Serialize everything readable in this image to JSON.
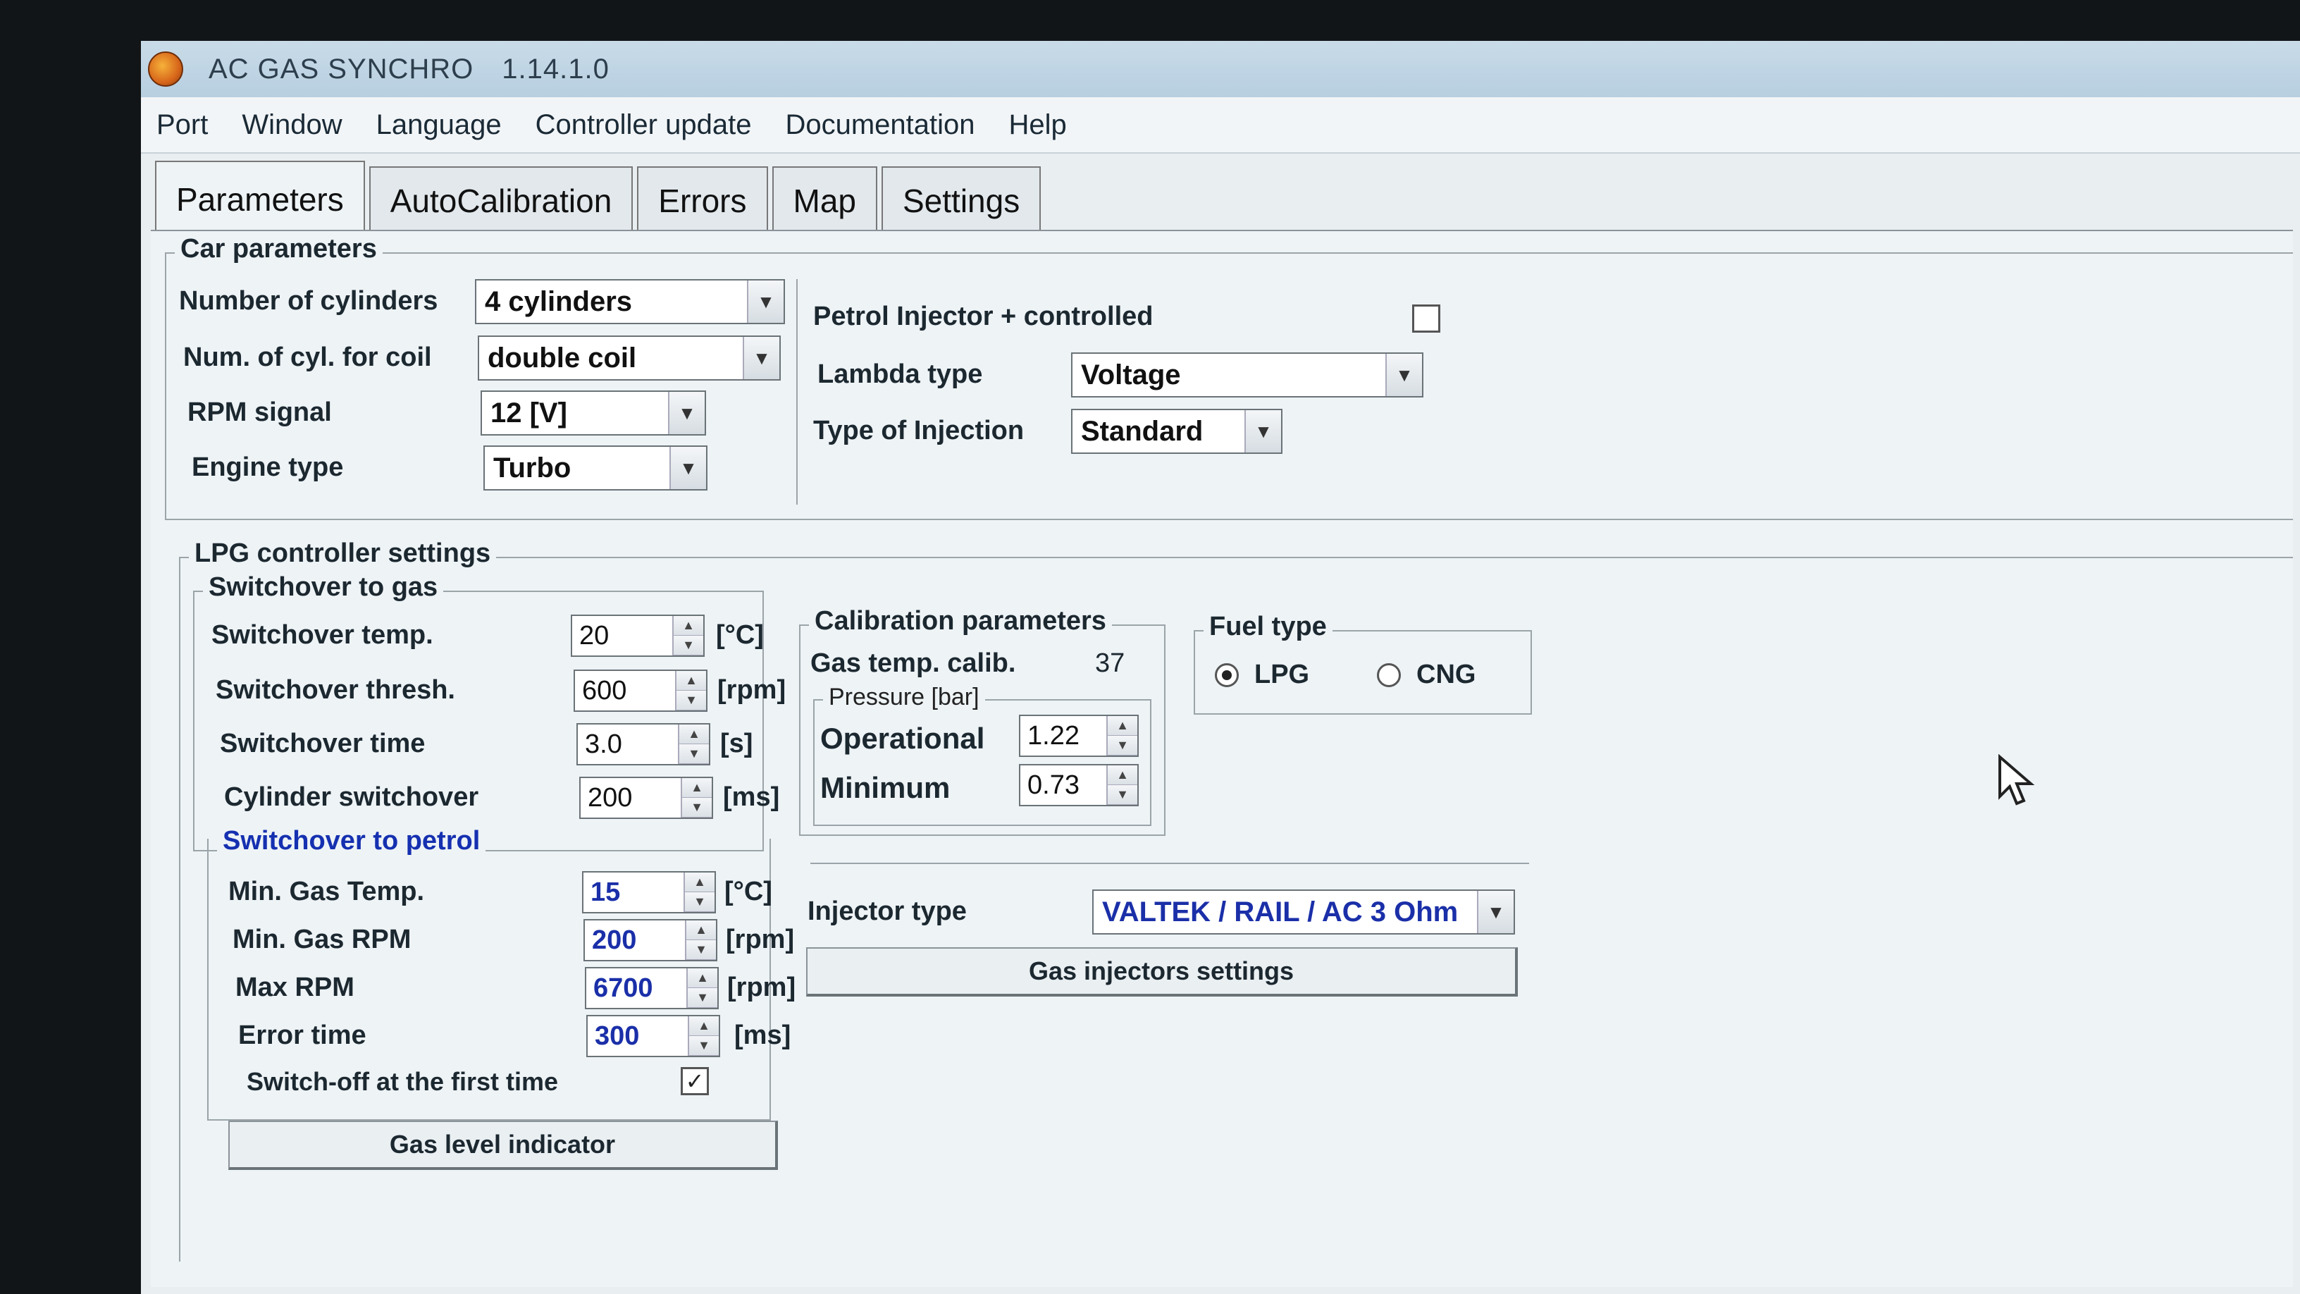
{
  "window": {
    "title": "AC GAS SYNCHRO",
    "version": "1.14.1.0"
  },
  "menu": [
    "Port",
    "Window",
    "Language",
    "Controller update",
    "Documentation",
    "Help"
  ],
  "tabs": [
    "Parameters",
    "AutoCalibration",
    "Errors",
    "Map",
    "Settings"
  ],
  "car_parameters": {
    "legend": "Car parameters",
    "num_cylinders_label": "Number of cylinders",
    "num_cylinders_value": "4 cylinders",
    "cyl_for_coil_label": "Num. of cyl. for coil",
    "cyl_for_coil_value": "double coil",
    "rpm_signal_label": "RPM signal",
    "rpm_signal_value": "12 [V]",
    "engine_type_label": "Engine type",
    "engine_type_value": "Turbo",
    "petrol_injector_label": "Petrol Injector + controlled",
    "lambda_type_label": "Lambda type",
    "lambda_type_value": "Voltage",
    "injection_type_label": "Type of Injection",
    "injection_type_value": "Standard"
  },
  "lpg_settings": {
    "legend": "LPG controller settings",
    "switchover_to_gas": {
      "legend": "Switchover to gas",
      "rows": [
        {
          "label": "Switchover temp.",
          "value": "20",
          "unit": "[°C]"
        },
        {
          "label": "Switchover thresh.",
          "value": "600",
          "unit": "[rpm]"
        },
        {
          "label": "Switchover time",
          "value": "3.0",
          "unit": "[s]"
        },
        {
          "label": "Cylinder switchover",
          "value": "200",
          "unit": "[ms]"
        }
      ]
    },
    "switchover_to_petrol": {
      "legend": "Switchover to petrol",
      "rows": [
        {
          "label": "Min. Gas Temp.",
          "value": "15",
          "unit": "[°C]"
        },
        {
          "label": "Min. Gas RPM",
          "value": "200",
          "unit": "[rpm]"
        },
        {
          "label": "Max RPM",
          "value": "6700",
          "unit": "[rpm]"
        },
        {
          "label": "Error time",
          "value": "300",
          "unit": "[ms]"
        }
      ],
      "switch_off_label": "Switch-off at the first time"
    },
    "gas_level_button": "Gas level indicator",
    "calibration": {
      "legend": "Calibration parameters",
      "gas_temp_label": "Gas temp. calib.",
      "gas_temp_value": "37",
      "pressure_legend": "Pressure [bar]",
      "operational_label": "Operational",
      "operational_value": "1.22",
      "minimum_label": "Minimum",
      "minimum_value": "0.73"
    },
    "fuel_type": {
      "legend": "Fuel type",
      "lpg": "LPG",
      "cng": "CNG",
      "selected": "LPG"
    },
    "injector_type_label": "Injector type",
    "injector_type_value": "VALTEK / RAIL / AC 3 Ohm",
    "gas_injectors_button": "Gas injectors settings"
  },
  "icons": {
    "dropdown": "▼",
    "check": "✓",
    "spin_up": "▲",
    "spin_down": "▼"
  }
}
